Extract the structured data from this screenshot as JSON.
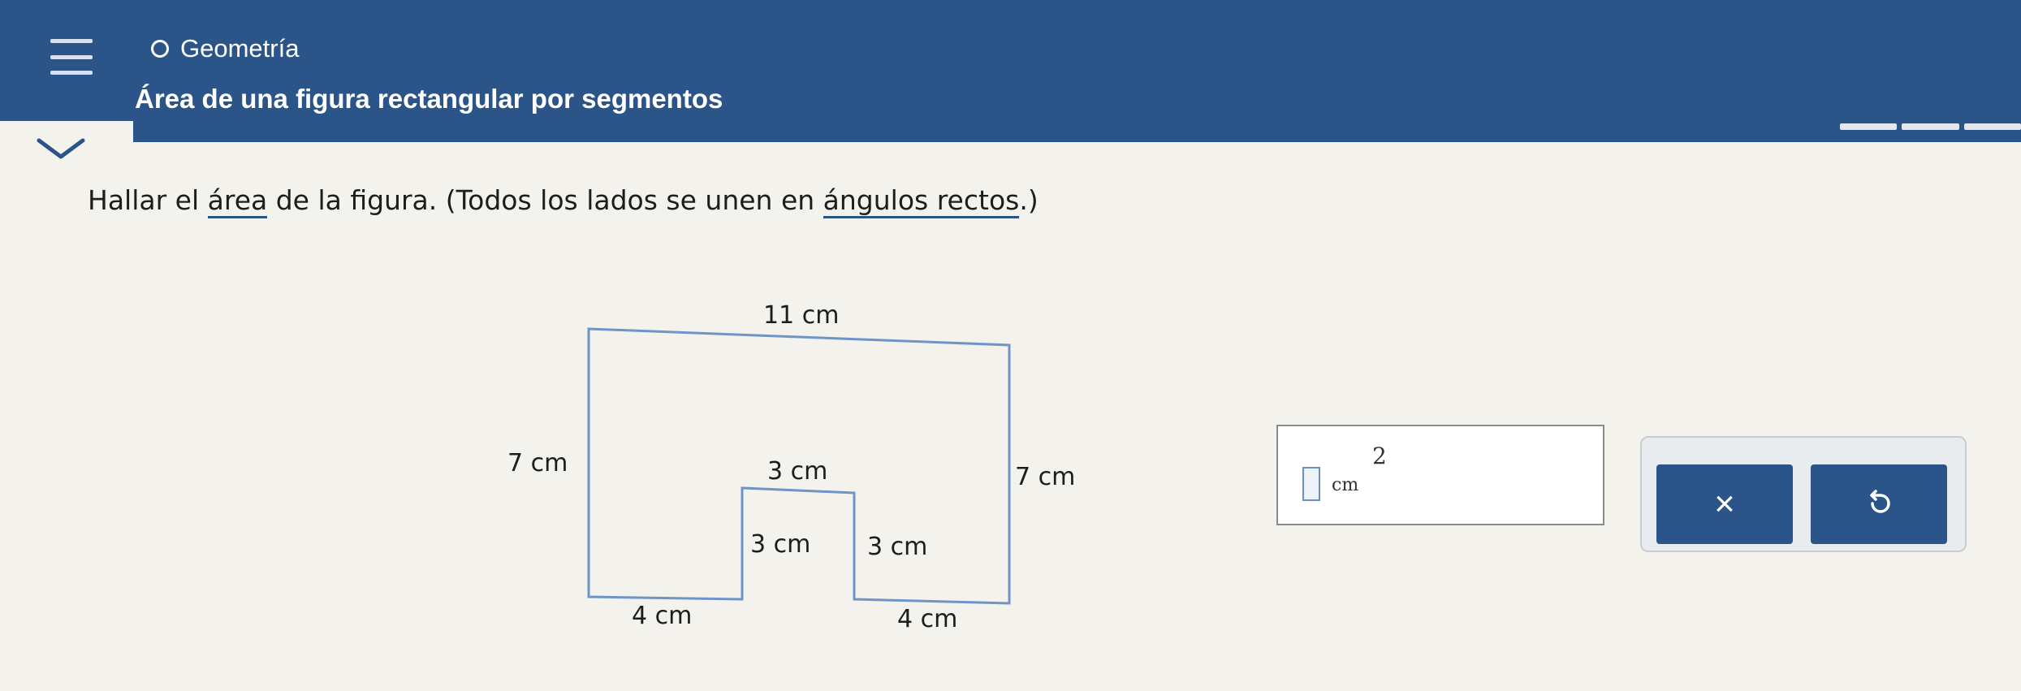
{
  "header": {
    "topic": "Geometría",
    "lesson_title": "Área de una figura rectangular por segmentos"
  },
  "question": {
    "prefix": "Hallar el ",
    "link1": "área",
    "middle": " de la figura. (Todos los lados se unen en ",
    "link2": "ángulos rectos",
    "suffix": ".)"
  },
  "figure": {
    "labels": {
      "top": "11 cm",
      "left": "7 cm",
      "right": "7 cm",
      "notch_top": "3 cm",
      "notch_left": "3 cm",
      "notch_right": "3 cm",
      "bottom_left": "4 cm",
      "bottom_right": "4 cm"
    }
  },
  "answer": {
    "value": "",
    "unit": "cm",
    "exponent": "2"
  },
  "buttons": {
    "clear": "×",
    "undo_icon": "undo-icon"
  },
  "colors": {
    "header": "#2b5488",
    "button": "#2b5488",
    "figure_stroke": "#6f95c8"
  }
}
